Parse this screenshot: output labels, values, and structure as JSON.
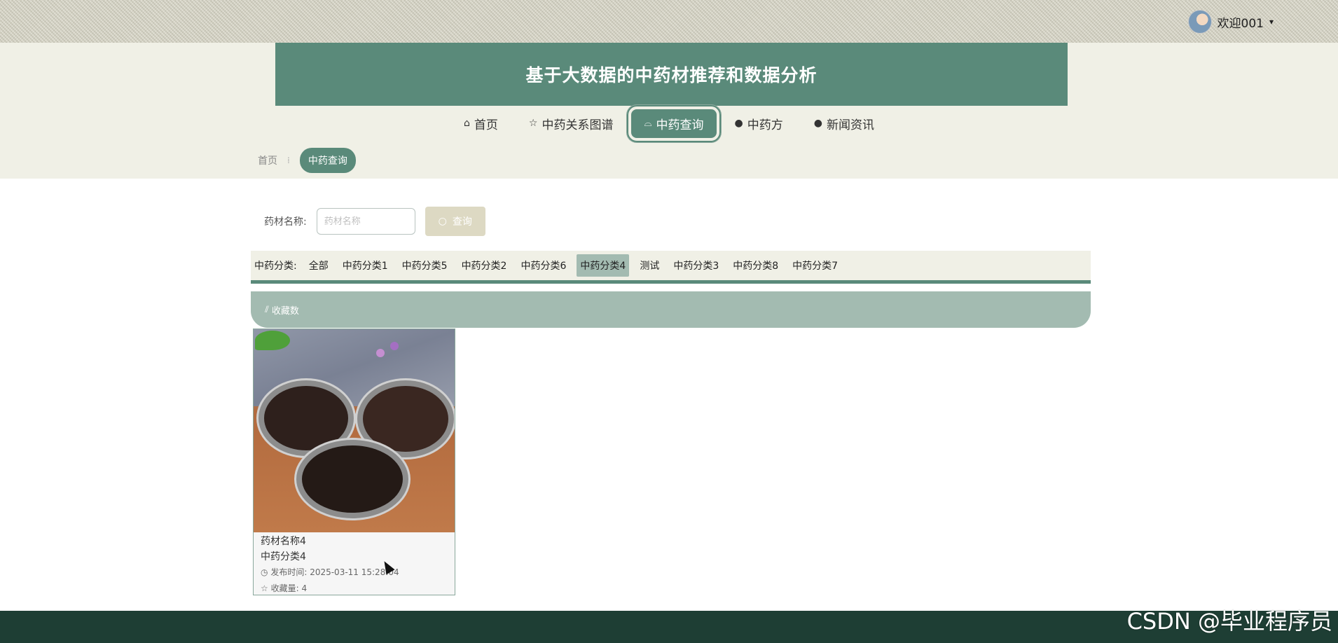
{
  "user": {
    "greeting": "欢迎001",
    "caret": "▾"
  },
  "header": {
    "title": "基于大数据的中药材推荐和数据分析"
  },
  "nav": {
    "items": [
      {
        "icon": "⌂",
        "label": "首页"
      },
      {
        "icon": "☆",
        "label": "中药关系图谱"
      },
      {
        "icon": "⌓",
        "label": "中药查询"
      },
      {
        "icon": "●",
        "label": "中药方"
      },
      {
        "icon": "●",
        "label": "新闻资讯"
      }
    ]
  },
  "breadcrumb": {
    "home": "首页",
    "separator": "⁞",
    "current": "中药查询"
  },
  "search": {
    "label": "药材名称:",
    "placeholder": "药材名称",
    "value": "",
    "button_icon": "○",
    "button_label": "查询"
  },
  "category": {
    "label": "中药分类:",
    "items": [
      "全部",
      "中药分类1",
      "中药分类5",
      "中药分类2",
      "中药分类6",
      "中药分类4",
      "测试",
      "中药分类3",
      "中药分类8",
      "中药分类7"
    ]
  },
  "sort": {
    "icon": "⫽",
    "label": "收藏数"
  },
  "products": [
    {
      "name": "药材名称4",
      "category": "中药分类4",
      "time_label": "发布时间:",
      "time_value": "2025-03-11 15:28:04",
      "fav_label": "收藏量:",
      "fav_value": "4"
    }
  ],
  "watermark": "CSDN @毕业程序员",
  "colors": {
    "primary": "#5a8a7a",
    "accent_light": "#a3bbb1",
    "beige": "#f0f0e6",
    "footer": "#1e3e34",
    "search_button": "#ddd9c3"
  }
}
